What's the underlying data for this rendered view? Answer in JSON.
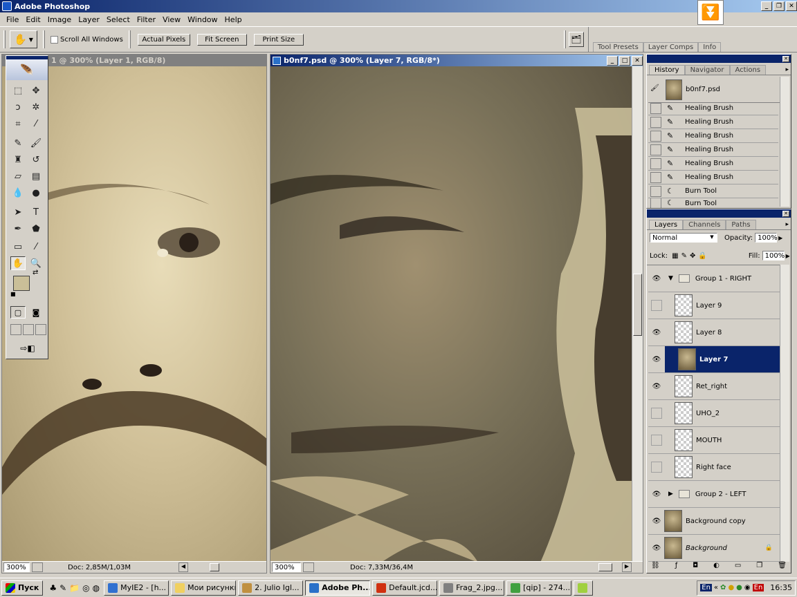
{
  "app": {
    "title": "Adobe Photoshop"
  },
  "menu": [
    "File",
    "Edit",
    "Image",
    "Layer",
    "Select",
    "Filter",
    "View",
    "Window",
    "Help"
  ],
  "options": {
    "scroll_all": "Scroll All Windows",
    "actual_pixels": "Actual Pixels",
    "fit_screen": "Fit Screen",
    "print_size": "Print Size",
    "palette_tabs": [
      "Tool Presets",
      "Layer Comps",
      "Info"
    ]
  },
  "doc_left": {
    "title": "1 @ 300% (Layer 1, RGB/8)",
    "zoom": "300%",
    "doc": "Doc: 2,85M/1,03M"
  },
  "doc_right": {
    "title": "b0nf7.psd @ 300% (Layer 7, RGB/8*)",
    "zoom": "300%",
    "doc": "Doc: 7,33M/36,4M"
  },
  "history": {
    "tabs": [
      "History",
      "Navigator",
      "Actions"
    ],
    "snapshot": "b0nf7.psd",
    "items": [
      "Healing Brush",
      "Healing Brush",
      "Healing Brush",
      "Healing Brush",
      "Healing Brush",
      "Healing Brush",
      "Burn Tool",
      "Burn Tool"
    ]
  },
  "layers": {
    "tabs": [
      "Layers",
      "Channels",
      "Paths"
    ],
    "blend": "Normal",
    "opacity_label": "Opacity:",
    "opacity": "100%",
    "lock_label": "Lock:",
    "fill_label": "Fill:",
    "fill": "100%",
    "items": [
      {
        "name": "Group 1 - RIGHT",
        "visible": true,
        "type": "group"
      },
      {
        "name": "Layer 9",
        "visible": false,
        "type": "layer"
      },
      {
        "name": "Layer 8",
        "visible": true,
        "type": "layer"
      },
      {
        "name": "Layer 7",
        "visible": true,
        "type": "image",
        "selected": true
      },
      {
        "name": "Ret_right",
        "visible": true,
        "type": "layer"
      },
      {
        "name": "UHO_2",
        "visible": false,
        "type": "layer"
      },
      {
        "name": "MOUTH",
        "visible": false,
        "type": "layer"
      },
      {
        "name": "Right face",
        "visible": false,
        "type": "layer"
      },
      {
        "name": "Group 2 - LEFT",
        "visible": true,
        "type": "group"
      },
      {
        "name": "Background copy",
        "visible": true,
        "type": "image"
      },
      {
        "name": "Background",
        "visible": true,
        "type": "image"
      }
    ]
  },
  "taskbar": {
    "start": "Пуск",
    "tasks": [
      "MyIE2 - [h...",
      "Мои рисунки",
      "2. Julio Igl...",
      "Adobe Ph...",
      "Default.jcd...",
      "Frag_2.jpg...",
      "[qip] - 274..."
    ],
    "lang": "En",
    "time": "16:35"
  }
}
